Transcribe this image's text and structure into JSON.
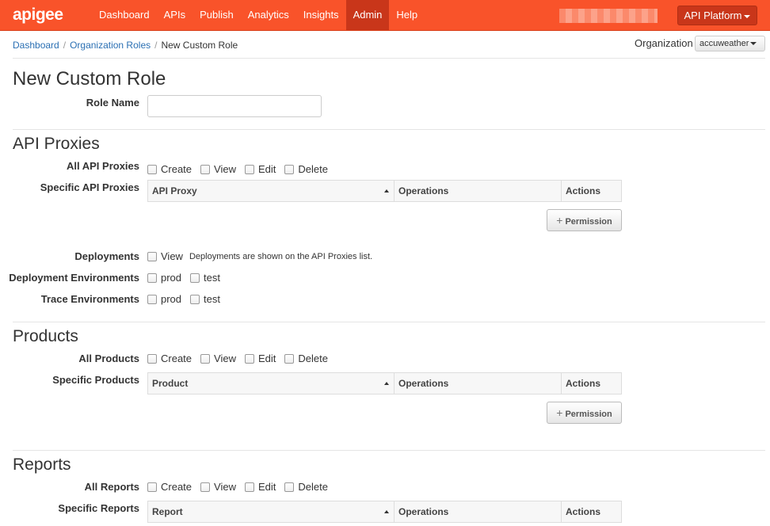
{
  "nav": {
    "logo": "apigee",
    "items": [
      {
        "label": "Dashboard",
        "active": false
      },
      {
        "label": "APIs",
        "active": false
      },
      {
        "label": "Publish",
        "active": false
      },
      {
        "label": "Analytics",
        "active": false
      },
      {
        "label": "Insights",
        "active": false
      },
      {
        "label": "Admin",
        "active": true
      },
      {
        "label": "Help",
        "active": false
      }
    ],
    "platform_label": "API Platform"
  },
  "breadcrumb": {
    "items": [
      "Dashboard",
      "Organization Roles"
    ],
    "current": "New Custom Role"
  },
  "org": {
    "label": "Organization",
    "selected": "accuweather"
  },
  "form": {
    "title": "New Custom Role",
    "role_name_label": "Role Name",
    "role_name_value": "",
    "api_proxies": {
      "heading": "API Proxies",
      "all_label": "All API Proxies",
      "all_options": [
        "Create",
        "View",
        "Edit",
        "Delete"
      ],
      "specific_label": "Specific API Proxies",
      "columns": [
        "API Proxy",
        "Operations",
        "Actions"
      ],
      "add_button": "Permission",
      "deployments_label": "Deployments",
      "deployments_option": "View",
      "deployments_hint": "Deployments are shown on the API Proxies list.",
      "deploy_env_label": "Deployment Environments",
      "deploy_env_options": [
        "prod",
        "test"
      ],
      "trace_env_label": "Trace Environments",
      "trace_env_options": [
        "prod",
        "test"
      ]
    },
    "products": {
      "heading": "Products",
      "all_label": "All Products",
      "all_options": [
        "Create",
        "View",
        "Edit",
        "Delete"
      ],
      "specific_label": "Specific Products",
      "columns": [
        "Product",
        "Operations",
        "Actions"
      ],
      "add_button": "Permission"
    },
    "reports": {
      "heading": "Reports",
      "all_label": "All Reports",
      "all_options": [
        "Create",
        "View",
        "Edit",
        "Delete"
      ],
      "specific_label": "Specific Reports",
      "columns": [
        "Report",
        "Operations",
        "Actions"
      ]
    }
  },
  "colors": {
    "nav_bg": "#f9532a",
    "nav_active": "#c9361a",
    "link": "#2a6fb3"
  }
}
